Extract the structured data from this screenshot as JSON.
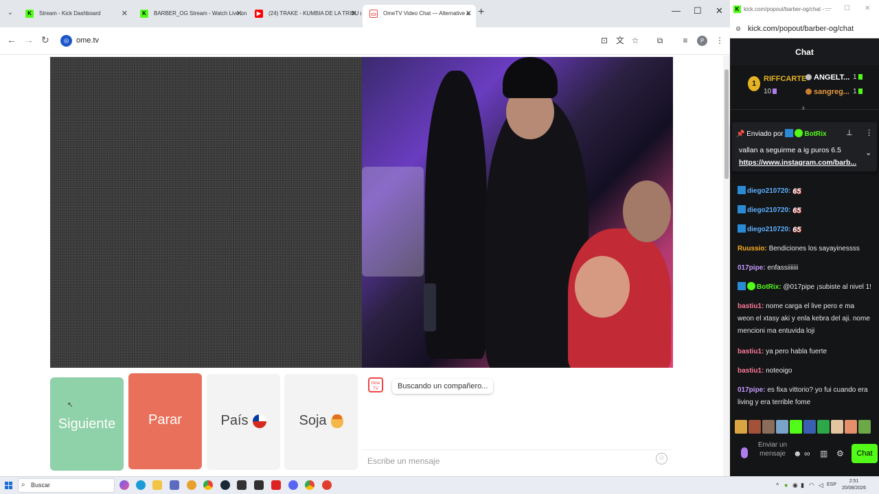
{
  "browser": {
    "tabs": [
      {
        "title": "Stream - Kick Dashboard",
        "favicon": "kick-icon"
      },
      {
        "title": "BARBER_OG Stream - Watch Live on Kick",
        "favicon": "kick-icon"
      },
      {
        "title": "(24) TRAKE - KUMBIA DE LA TRIBU (",
        "favicon": "youtube-icon"
      },
      {
        "title": "OmeTV Video Chat — Alternative a",
        "favicon": "ometv-icon"
      }
    ],
    "address": "ome.tv"
  },
  "ometv": {
    "buttons": {
      "next": "Siguiente",
      "stop": "Parar",
      "country": "País",
      "gender": "Soja"
    },
    "status_message": "Buscando un compañero...",
    "logo_text": "Ome TV",
    "message_placeholder": "Escribe un mensaje"
  },
  "kick": {
    "window_url_short": "kick.com/popout/barber-og/chat - ...",
    "url": "kick.com/popout/barber-og/chat",
    "header": "Chat",
    "leaderboard": {
      "first": {
        "rank": "1",
        "name": "RIFFCARTE",
        "count": "10"
      },
      "second": {
        "name": "ANGELT...",
        "count": "1"
      },
      "third": {
        "name": "sangreg...",
        "count": "1"
      }
    },
    "pinned": {
      "sent_by_label": "Enviado por",
      "sent_by_user": "BotRix",
      "text": "vallan a seguirme a ig puros 6.5",
      "link": "https://www.instagram.com/barb..."
    },
    "messages": [
      {
        "user": "diego210720:",
        "text": "",
        "emote": "65"
      },
      {
        "user": "diego210720:",
        "text": "",
        "emote": "65"
      },
      {
        "user": "diego210720:",
        "text": "",
        "emote": "65"
      },
      {
        "user": "Ruussio:",
        "text": "Bendiciones los sayayinessss"
      },
      {
        "user": "017pipe:",
        "text": "enfassiiiiiii"
      },
      {
        "user": "BotRix:",
        "text": "@017pipe ¡subiste al nivel 1!"
      },
      {
        "user": "bastiu1:",
        "text": "nome carga el live pero e ma weon el xtasy aki y enla kebra del aji. nome mencioni ma entuvida loji"
      },
      {
        "user": "bastiu1:",
        "text": "ya pero habla fuerte"
      },
      {
        "user": "bastiu1:",
        "text": "noteoigo"
      },
      {
        "user": "017pipe:",
        "text": "es fixa vittorio? yo fui cuando era living y era terrible fome"
      }
    ],
    "input_placeholder": "Enviar un mensaje",
    "chat_button": "Chat"
  },
  "taskbar": {
    "search_placeholder": "Buscar",
    "time": "2:51",
    "date": "20/08/2026",
    "lang": "ESP"
  },
  "colors": {
    "kick_green": "#53fc18",
    "next_button": "#8fd1a8",
    "stop_button": "#e9705a"
  }
}
